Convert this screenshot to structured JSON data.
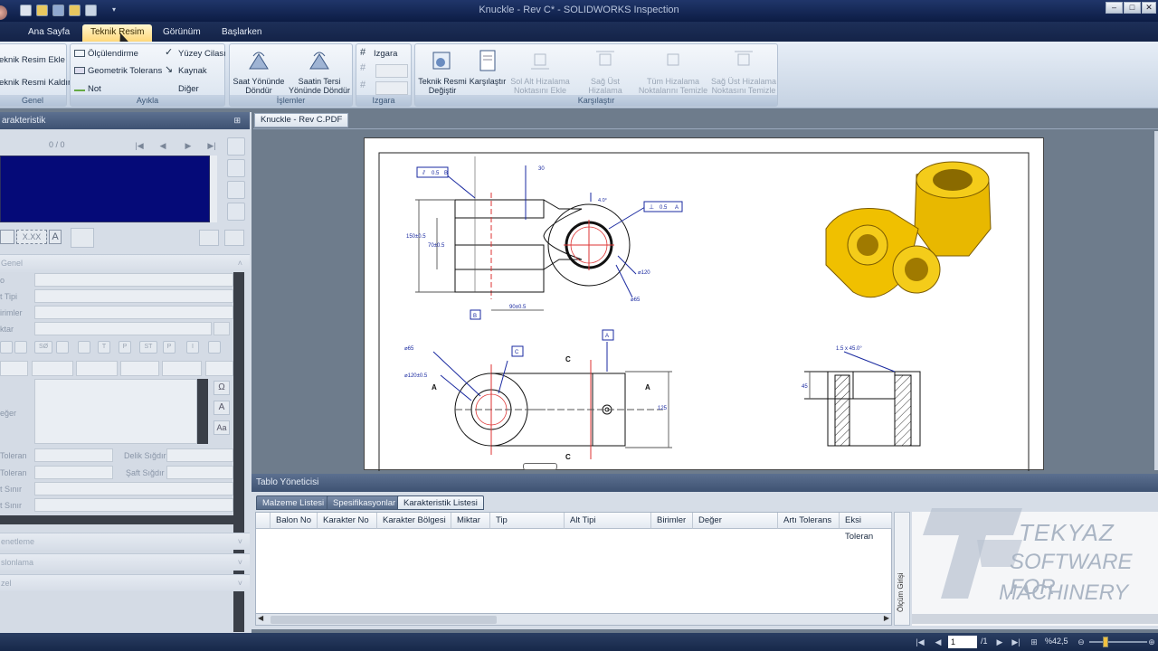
{
  "window": {
    "title": "Knuckle - Rev C* - SOLIDWORKS Inspection",
    "controls": [
      "–",
      "□",
      "✕"
    ]
  },
  "ribbon": {
    "tabs": [
      "Ana Sayfa",
      "Teknik Resim",
      "Görünüm",
      "Başlarken"
    ],
    "active_tab": "Teknik Resim",
    "groups": {
      "genel": {
        "label": "Genel",
        "items": [
          "eknik Resim Ekle",
          "eknik Resmi Kaldır"
        ]
      },
      "aykla": {
        "label": "Ayıkla",
        "items": [
          "Ölçülendirme",
          "Geometrik Tolerans",
          "Not",
          "Yüzey Cilası",
          "Kaynak",
          "Diğer"
        ]
      },
      "islemler": {
        "label": "İşlemler",
        "items": [
          "Saat Yönünde Döndür",
          "Saatin Tersi Yönünde Döndür"
        ]
      },
      "izgara": {
        "label": "Izgara",
        "items": [
          "Izgara"
        ]
      },
      "karsilastir": {
        "label": "Karşılaştır",
        "items": [
          "Teknik Resmi Değiştir",
          "Karşılaştır",
          "Sol Alt Hizalama Noktasını Ekle",
          "Sağ Üst Hizalama Noktasını Ekle",
          "Tüm Hizalama Noktalarını Temizle",
          "Sağ Üst Hizalama Noktasını Temizle"
        ]
      }
    }
  },
  "left_panel": {
    "title": "arakteristik",
    "counter": "0 / 0",
    "sections": {
      "genel": "Genel",
      "yoneticileme": "enetleme",
      "yaslonlama": "slonlama",
      "ozel": "zel"
    },
    "field_labels": [
      "o",
      "t Tipi",
      "irimler",
      "ktar",
      "eğer",
      "Toleran",
      "Toleran",
      "t Sınır",
      "t Sınır"
    ],
    "delik_sigdir": "Delik Sığdır",
    "saft_sigdir": "Şaft Sığdır",
    "format_xxx": "X.XX",
    "format_a": "A"
  },
  "document": {
    "tab": "Knuckle - Rev C.PDF"
  },
  "drawing": {
    "labels": {
      "dim_30": "30",
      "dim_30_tol": "+1\n-0.5",
      "dim_4deg": "4.0°",
      "dim_150": "150±0.5",
      "dim_70": "70±0.5",
      "dim_90": "90±0.5",
      "dim_phi120top": "⌀120",
      "dim_phi120top_tol": "+1\n-0.5",
      "dim_phi65top": "⌀65",
      "fcf_flat": "0.5",
      "fcf_flat_ref": "B",
      "fcf_perp": "0.5",
      "fcf_perp_ref": "A",
      "datum_b": "B",
      "datum_a": "A",
      "datum_c": "C",
      "dim_phi65_front": "⌀65",
      "dim_phi65_front_tol": "+0.5\n-0.5",
      "dim_phi120_front": "⌀120±0.5",
      "dim_125": "125",
      "dim_125_tol": "+1\n-0.5",
      "dim_chamfer": "1.5 x 45.0°",
      "dim_45": "45",
      "sect_a1": "A",
      "sect_a2": "A",
      "sect_c1": "C",
      "sect_c2": "C"
    }
  },
  "table_manager": {
    "title": "Tablo Yöneticisi",
    "tabs": [
      "Malzeme Listesi",
      "Spesifikasyonlar",
      "Karakteristik Listesi"
    ],
    "active_tab": "Karakteristik Listesi",
    "columns": [
      "Balon No",
      "Karakter No",
      "Karakter Bölgesi",
      "Miktar",
      "Tip",
      "Alt Tipi",
      "Birimler",
      "Değer",
      "Artı Tolerans",
      "Eksi Toleran"
    ],
    "side_label": "Ölçüm Girişi"
  },
  "watermark": {
    "line1": "TEKYAZ",
    "line2": "SOFTWARE FOR",
    "line3": "MACHINERY"
  },
  "statusbar": {
    "page": "1",
    "page_total": "/1",
    "zoom": "%42,5"
  }
}
